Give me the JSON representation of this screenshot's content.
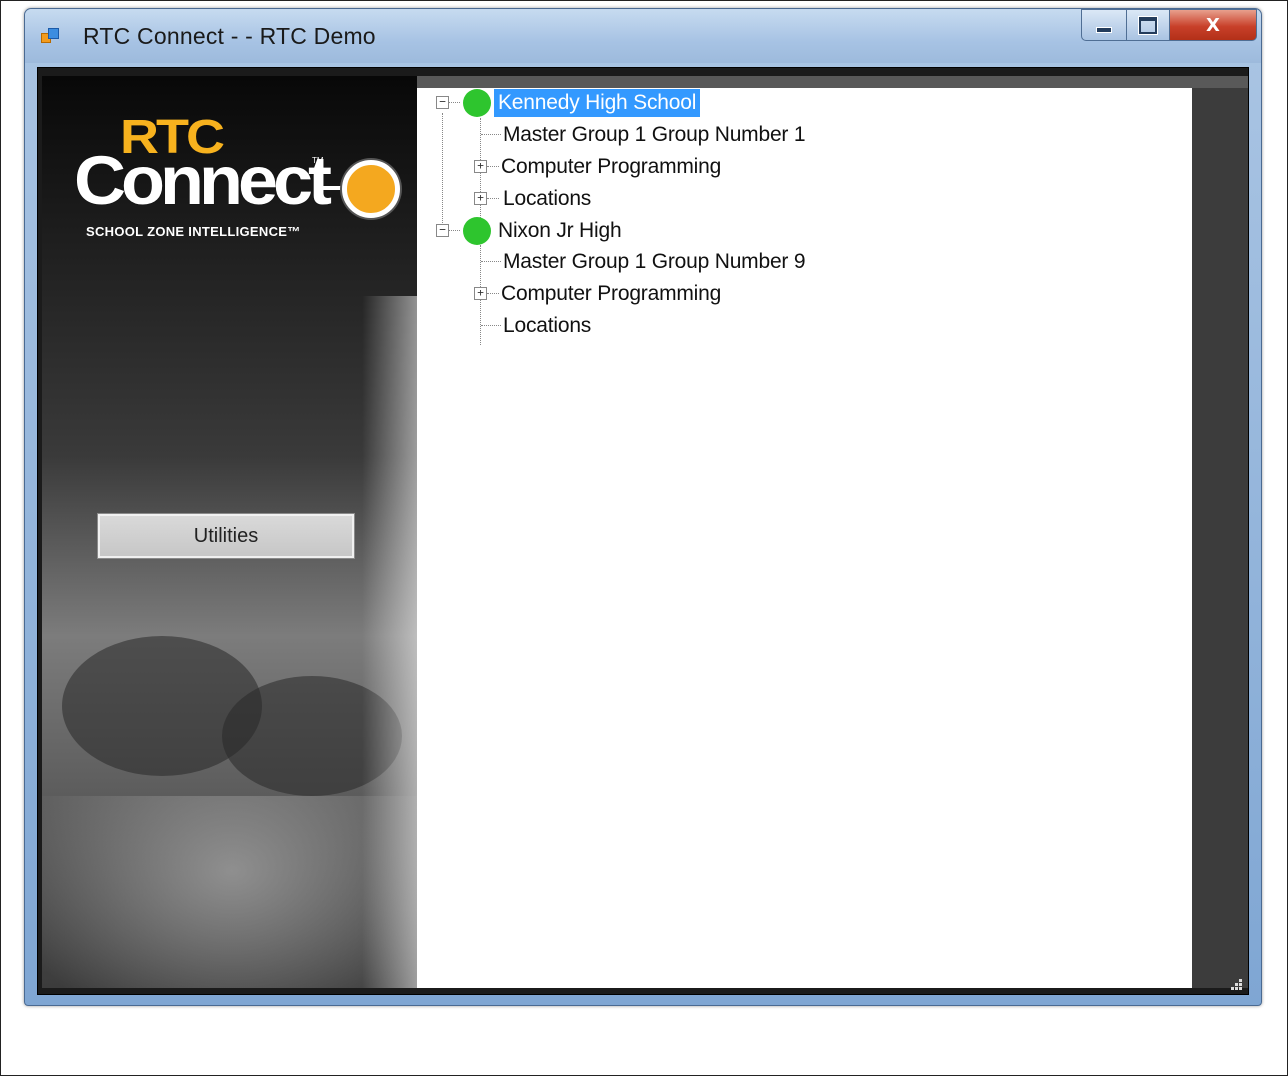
{
  "window": {
    "title": "RTC Connect - -  RTC Demo",
    "controls": {
      "minimize": "minimize",
      "maximize": "maximize",
      "close": "X"
    }
  },
  "logo": {
    "rtc": "RTC",
    "connect": "Connect",
    "tm": "TM",
    "tagline": "SCHOOL ZONE INTELLIGENCE™"
  },
  "sidebar": {
    "utilities_label": "Utilities"
  },
  "tree": {
    "schools": [
      {
        "name": "Kennedy High School",
        "status_color": "#2ec52e",
        "selected": true,
        "children": [
          {
            "label": "Master Group 1 Group Number 1",
            "expandable": false
          },
          {
            "label": "Computer Programming",
            "expandable": true
          },
          {
            "label": "Locations",
            "expandable": true
          }
        ]
      },
      {
        "name": "Nixon Jr High",
        "status_color": "#2ec52e",
        "selected": false,
        "children": [
          {
            "label": "Master Group 1 Group Number 9",
            "expandable": false
          },
          {
            "label": "Computer Programming",
            "expandable": true
          },
          {
            "label": "Locations",
            "expandable": false
          }
        ]
      }
    ]
  },
  "colors": {
    "selection": "#3399ff",
    "status_online": "#2ec52e",
    "logo_orange": "#f4a81f"
  }
}
